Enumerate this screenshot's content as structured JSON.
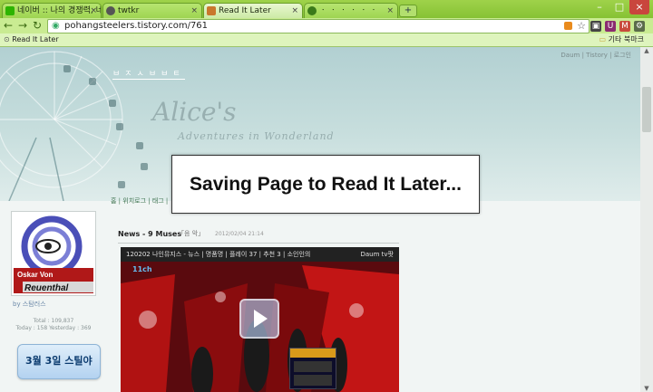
{
  "browser": {
    "tabs": [
      {
        "label": "네이버 :: 나의 경쟁력, 네이"
      },
      {
        "label": "twtkr"
      },
      {
        "label": "Read It Later"
      },
      {
        "label": "ㆍ ㆍ ㆍ ㆍ ㆍ ㆍ"
      }
    ],
    "new_tab": "+",
    "url": "pohangsteelers.tistory.com/761",
    "bookmarks": {
      "left": "Read It Later",
      "right": "기타 북마크"
    }
  },
  "blog": {
    "title": "ㅂㅈㅅㅂㅂㅌ",
    "script_title": "Alice's",
    "script_subtitle": "Adventures in Wonderland",
    "top_links": "Daum | Tistory | 로그인",
    "menu": "홈 | 위치로그 | 태그 |",
    "profile_line1": "Oskar Von",
    "profile_line2": "Reuenthal",
    "byline": "by 스탐러스",
    "total": "Total : 109,837",
    "today": "Today : 158  Yesterday : 369",
    "banner": "3월 3일 스틸야"
  },
  "post": {
    "title": "News - 9 Muses",
    "category": "「음 악」",
    "date": "2012/02/04 21:14",
    "video": {
      "caption": "120202 나인뮤지스 - 뉴스 | 명품명 | 플레이 37 | 추천 3 | 소인인의",
      "source": "Daum tv팟",
      "channel_logo": "11ch"
    }
  },
  "overlay": {
    "message": "Saving Page to Read It Later..."
  },
  "colors": {
    "chrome_green": "#9fd24a",
    "overlay_bg": "#ffffff",
    "banner_text": "#0a3a6e"
  }
}
